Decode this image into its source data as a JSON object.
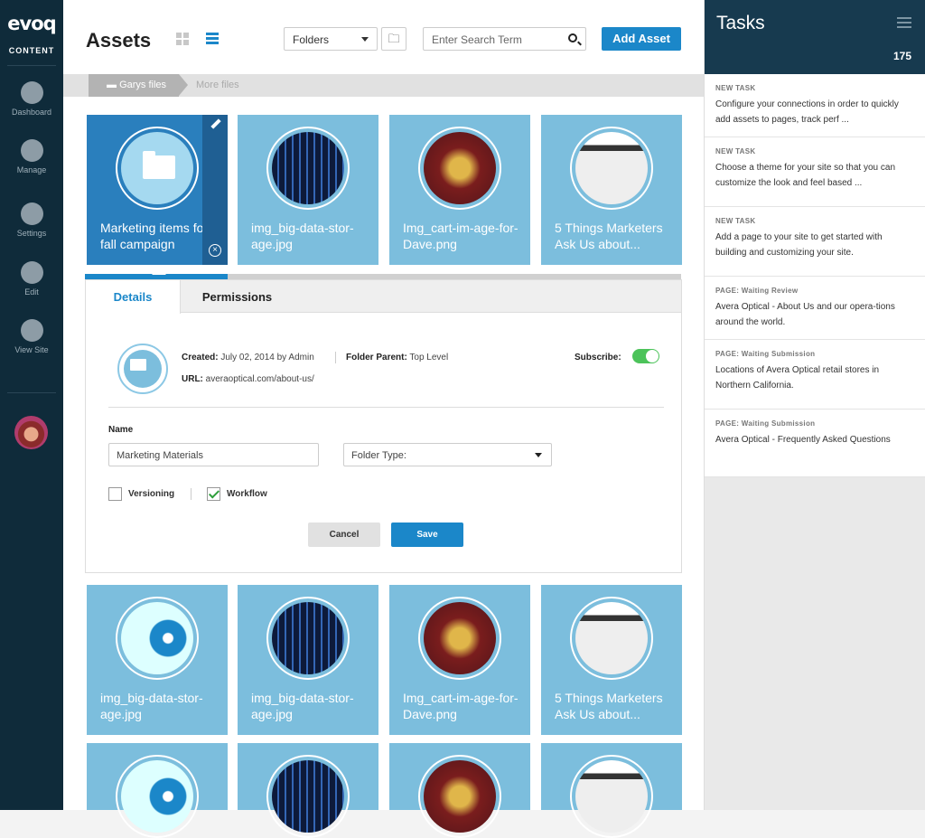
{
  "sidebar": {
    "logo": "evoq",
    "brand": "CONTENT",
    "items": [
      {
        "label": "Dashboard"
      },
      {
        "label": "Manage"
      },
      {
        "label": "Settings"
      },
      {
        "label": "Edit"
      },
      {
        "label": "View Site"
      }
    ]
  },
  "header": {
    "title": "Assets",
    "folder_select": "Folders",
    "search_placeholder": "Enter Search Term",
    "add_label": "Add Asset"
  },
  "breadcrumb": {
    "current": "Garys files",
    "next": "More files"
  },
  "tiles_top": [
    {
      "name": "Marketing items for fall campaign",
      "kind": "folder",
      "selected": true
    },
    {
      "name": "img_big-data-stor-age.jpg",
      "kind": "server"
    },
    {
      "name": "Img_cart-im-age-for-Dave.png",
      "kind": "cart"
    },
    {
      "name": "5 Things Marketers Ask Us about...",
      "kind": "web"
    }
  ],
  "tiles_bottom": [
    {
      "name": "img_big-data-stor-age.jpg",
      "kind": "disc"
    },
    {
      "name": "img_big-data-stor-age.jpg",
      "kind": "server"
    },
    {
      "name": "Img_cart-im-age-for-Dave.png",
      "kind": "cart"
    },
    {
      "name": "5 Things Marketers Ask Us about...",
      "kind": "web"
    }
  ],
  "details": {
    "progress_percent": 24,
    "tab_details": "Details",
    "tab_permissions": "Permissions",
    "created_label": "Created:",
    "created_value": "July 02, 2014 by Admin",
    "parent_label": "Folder Parent:",
    "parent_value": "Top Level",
    "url_label": "URL:",
    "url_value": "averaoptical.com/about-us/",
    "subscribe_label": "Subscribe:",
    "subscribe_on": true,
    "name_label": "Name",
    "name_value": "Marketing Materials",
    "folder_type": "Folder Type:",
    "versioning_label": "Versioning",
    "workflow_label": "Workflow",
    "versioning_checked": false,
    "workflow_checked": true,
    "cancel_label": "Cancel",
    "save_label": "Save"
  },
  "tasks": {
    "title": "Tasks",
    "count": "175",
    "items": [
      {
        "tag": "NEW TASK",
        "text": "Configure your connections in order to quickly add assets to pages, track perf ..."
      },
      {
        "tag": "NEW TASK",
        "text": "Choose a theme for your site so that you can customize the look and feel based ..."
      },
      {
        "tag": "NEW TASK",
        "text": "Add a page to your site to get started with building and customizing your site."
      },
      {
        "tag": "PAGE: Waiting Review",
        "text": "Avera Optical - About Us and our opera-tions around the world."
      },
      {
        "tag": "PAGE: Waiting Submission",
        "text": "Locations of Avera Optical retail stores in Northern California."
      },
      {
        "tag": "PAGE: Waiting Submission",
        "text": "Avera Optical - Frequently Asked Questions"
      }
    ]
  },
  "colors": {
    "accent": "#1b87c9",
    "sidebar": "#0f2b3a",
    "tile": "#7cbedd",
    "toggle_on": "#4cc35a"
  }
}
